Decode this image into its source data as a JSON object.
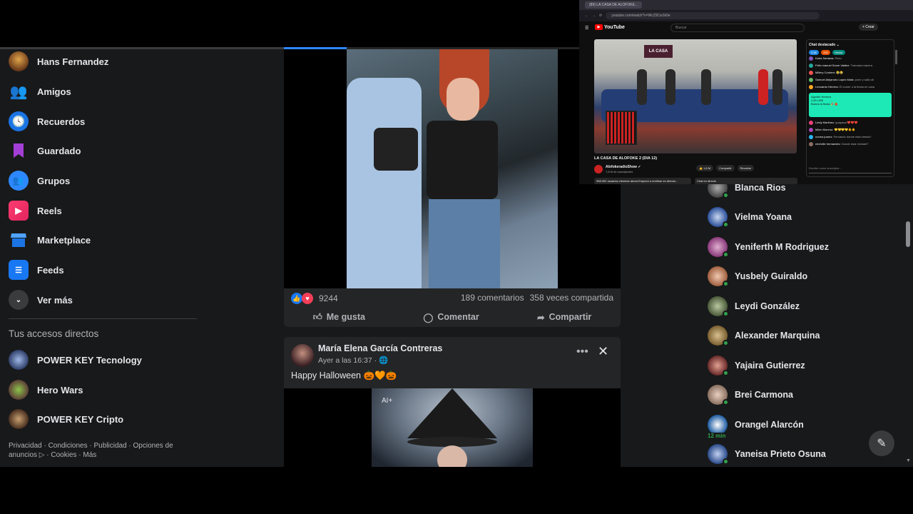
{
  "sidebar": {
    "items": [
      {
        "label": "Hans Fernandez",
        "icon": "profile-avatar"
      },
      {
        "label": "Amigos",
        "icon": "friends-icon"
      },
      {
        "label": "Recuerdos",
        "icon": "clock-icon"
      },
      {
        "label": "Guardado",
        "icon": "bookmark-icon"
      },
      {
        "label": "Grupos",
        "icon": "groups-icon"
      },
      {
        "label": "Reels",
        "icon": "reels-icon"
      },
      {
        "label": "Marketplace",
        "icon": "marketplace-icon"
      },
      {
        "label": "Feeds",
        "icon": "feeds-icon"
      },
      {
        "label": "Ver más",
        "icon": "chevron-down-icon"
      }
    ],
    "shortcuts_title": "Tus accesos directos",
    "shortcuts": [
      {
        "label": "POWER KEY Tecnology"
      },
      {
        "label": "Hero Wars"
      },
      {
        "label": "POWER KEY Cripto"
      }
    ],
    "footer": "Privacidad · Condiciones · Publicidad · Opciones de anuncios ▷ · Cookies · Más"
  },
  "post1": {
    "reaction_count": "9244",
    "comments": "189 comentarios",
    "shares": "358 veces compartida",
    "actions": {
      "like": "Me gusta",
      "comment": "Comentar",
      "share": "Compartir"
    }
  },
  "post2": {
    "author": "María Elena García Contreras",
    "time": "Ayer a las 16:37 · 🌐",
    "text": "Happy Halloween 🎃🧡🎃",
    "ai_label": "AI+"
  },
  "contacts": [
    {
      "name": "Blanca Rios"
    },
    {
      "name": "Vielma Yoana"
    },
    {
      "name": "Yeniferth M Rodriguez"
    },
    {
      "name": "Yusbely Guiraldo"
    },
    {
      "name": "Leydi González"
    },
    {
      "name": "Alexander Marquina"
    },
    {
      "name": "Yajaira Gutierrez"
    },
    {
      "name": "Brei Carmona"
    },
    {
      "name": "Orangel Alarcón",
      "badge": "12 min"
    },
    {
      "name": "Yaneisa Prieto Osuna"
    }
  ],
  "youtube": {
    "tab_title": "(89) LA CASA DE ALOFOKE...",
    "url": "youtube.com/watch?v=WcZ9Cw1k0e",
    "logo": "YouTube",
    "search_placeholder": "Buscar",
    "create": "+ Crear",
    "video_logo": "LA CASA",
    "video_title": "LA CASA DE ALOFOKE 2 (DIA 12)",
    "channel": "AlofokeradioShow ✓",
    "subscribers": "7,8 M de suscriptores",
    "likes": "👍 1,8 M",
    "share": "Compartir",
    "clip": "Recortar",
    "description": "958.052 usuarios viéndolo ahora  Empezó a emitirse en directo...",
    "chat_replay": "Chat en directo",
    "chat_title": "Chat destacado ⌄",
    "chat_pills": [
      "3,5K",
      "200",
      "Hector"
    ],
    "chat_messages": [
      {
        "user": "Karla Santana:",
        "text": "Pluto"
      },
      {
        "user": "Felix manuel Soom Valdez:",
        "text": "Tramada manera"
      },
      {
        "user": "Millery Cordero:",
        "text": "😂😂"
      },
      {
        "user": "Samuel Alejandro Lopez Mota:",
        "text": "pone y salió all"
      },
      {
        "user": "Leonardo Herrera:",
        "text": "El comer o la fiesta en casa"
      }
    ],
    "superchat_user": "Agustin Herrera",
    "superchat_amount": "1,50 US$",
    "superchat_text": "Buena la fiesta 🎉🍓",
    "chat_messages2": [
      {
        "user": "Leidy Martinez:",
        "text": "guapaaa ❤️❤️❤️"
      },
      {
        "user": "Milen Moreno:",
        "text": "💛💛💛💛🐥🐥"
      },
      {
        "user": "norma juarez:",
        "text": "Fernando donde está shelsa?"
      },
      {
        "user": "michelle hernandez:",
        "text": "Donde esta michael?"
      }
    ],
    "chat_placeholder": "Escribe como suscriptor..."
  }
}
